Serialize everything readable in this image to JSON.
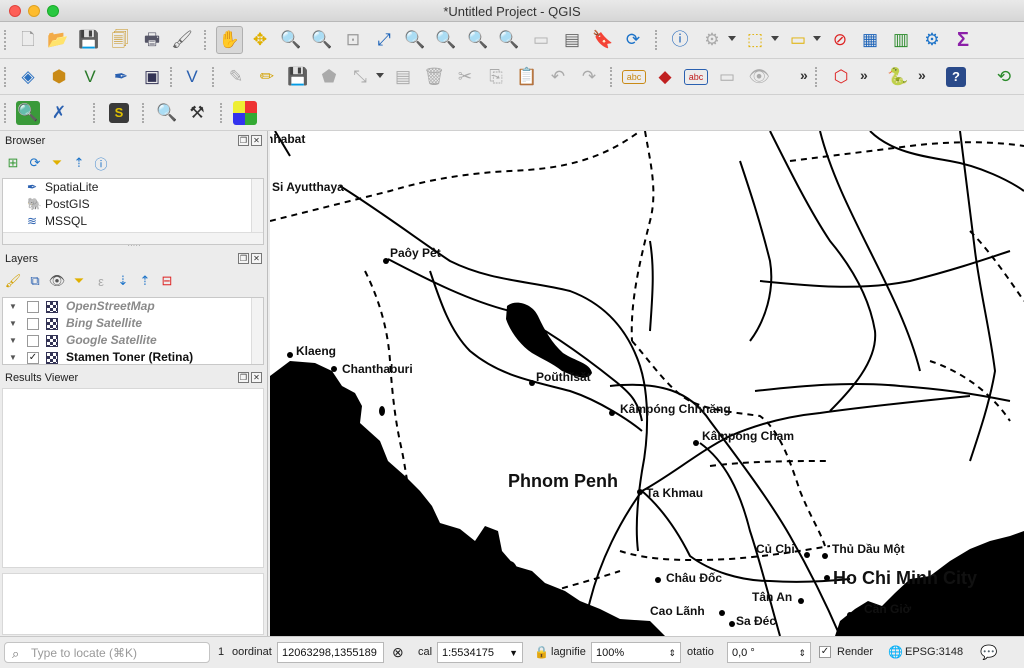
{
  "window": {
    "title": "*Untitled Project - QGIS"
  },
  "toolbar1": {
    "icons": [
      "new-project-icon",
      "open-project-icon",
      "save-project-icon",
      "save-as-icon",
      "print-layout-icon",
      "style-manager-icon",
      "pan-icon",
      "pan-to-selection-icon",
      "zoom-in-icon",
      "zoom-out-icon",
      "zoom-native-icon",
      "zoom-full-icon",
      "zoom-to-selection-icon",
      "zoom-to-layer-icon",
      "zoom-last-icon",
      "zoom-next-icon",
      "new-bookmark-icon",
      "show-bookmarks-icon",
      "spatial-bookmark-icon",
      "refresh-icon",
      "identify-icon",
      "measure-icon",
      "select-features-icon",
      "deselect-icon",
      "attribute-table-icon",
      "statistics-icon",
      "processing-toolbox-icon",
      "sum-icon"
    ]
  },
  "toolbar2": {
    "more": "»"
  },
  "panels": {
    "browser": {
      "title": "Browser",
      "items": [
        {
          "label": "SpatiaLite",
          "icon": "feather-icon"
        },
        {
          "label": "PostGIS",
          "icon": "elephant-icon"
        },
        {
          "label": "MSSQL",
          "icon": "mssql-icon"
        }
      ]
    },
    "layers": {
      "title": "Layers",
      "items": [
        {
          "label": "OpenStreetMap",
          "checked": false
        },
        {
          "label": "Bing Satellite",
          "checked": false
        },
        {
          "label": "Google Satellite",
          "checked": false
        },
        {
          "label": "Stamen Toner (Retina)",
          "checked": true
        }
      ]
    },
    "results": {
      "title": "Results Viewer"
    }
  },
  "map": {
    "labels": [
      {
        "text": "hhabat"
      },
      {
        "text": "Si Ayutthaya"
      },
      {
        "text": "Paôy Pêt"
      },
      {
        "text": "Klaeng"
      },
      {
        "text": "Chanthaburi"
      },
      {
        "text": "Poŭthĭsăt"
      },
      {
        "text": "Kâmpóng Chhnăng"
      },
      {
        "text": "Kâmpóng Cham"
      },
      {
        "text": "Phnom Penh"
      },
      {
        "text": "Ta Khmau"
      },
      {
        "text": "Củ Chi"
      },
      {
        "text": "Thủ Dầu Một"
      },
      {
        "text": "Châu Đốc"
      },
      {
        "text": "Ho Chi Minh City"
      },
      {
        "text": "Tân An"
      },
      {
        "text": "Cao Lãnh"
      },
      {
        "text": "Cần Giờ"
      },
      {
        "text": "Sa Đéc"
      }
    ]
  },
  "status": {
    "locate_placeholder": "Type to locate (⌘K)",
    "one": "1",
    "coord_label": "oordinat",
    "coord_value": "12063298,1355189",
    "scale_label": "cal",
    "scale_value": "1:5534175",
    "mag_label": "lagnifie",
    "mag_value": "100%",
    "rot_label": "otatio",
    "rot_value": "0,0 °",
    "render_label": "Render",
    "crs": "EPSG:3148"
  }
}
